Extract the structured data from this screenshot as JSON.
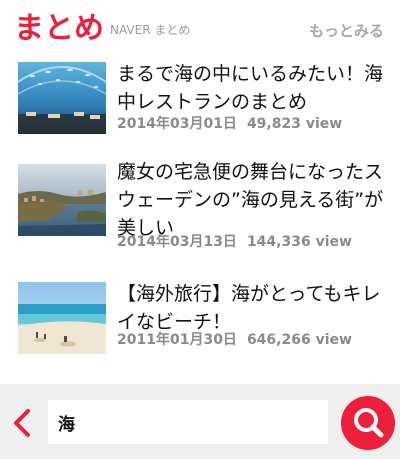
{
  "header": {
    "logo": "まとめ",
    "subtitle": "NAVER まとめ",
    "more_label": "もっとみる"
  },
  "articles": [
    {
      "title": "まるで海の中にいるみたい！海中レストランのまとめ",
      "date": "2014年03月01日",
      "views": "49,823 view",
      "thumb_icon": "underwater-restaurant-image"
    },
    {
      "title": "魔女の宅急便の舞台になったスウェーデンの”海の見える街”が美しい",
      "date": "2014年03月13日",
      "views": "144,336 view",
      "thumb_icon": "seaside-town-image"
    },
    {
      "title": "【海外旅行】海がとってもキレイなビーチ！",
      "date": "2011年01月30日",
      "views": "646,266 view",
      "thumb_icon": "beach-image"
    }
  ],
  "search": {
    "value": "海",
    "placeholder": ""
  },
  "icons": {
    "back": "chevron-left-icon",
    "search": "search-icon"
  },
  "colors": {
    "accent": "#ee1f3b",
    "bar_bg": "#efefef",
    "meta": "#8a8a8a"
  }
}
